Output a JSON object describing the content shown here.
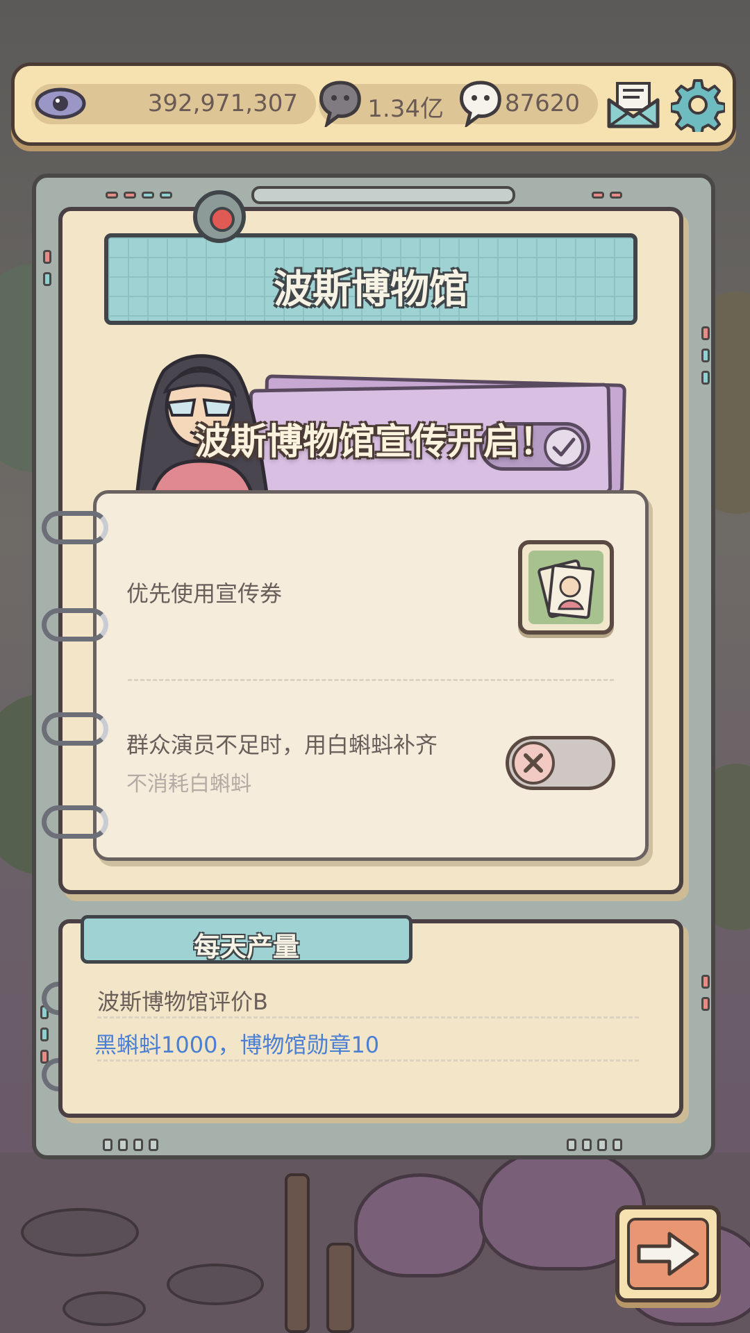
{
  "resources": {
    "views": "392,971,307",
    "gray_tadpoles": "1.34亿",
    "white_tadpoles": "87620"
  },
  "museum": {
    "title": "波斯博物馆",
    "promo_banner": "波斯博物馆宣传开启！"
  },
  "settings": {
    "option1_label": "优先使用宣传券",
    "option2_label": "群众演员不足时，用白蝌蚪补齐",
    "option2_sub": "不消耗白蝌蚪",
    "option2_enabled": false
  },
  "daily_output": {
    "tab_label": "每天产量",
    "rating_line": "波斯博物馆评价B",
    "rewards_line": "黑蝌蚪1000，博物馆勋章10"
  },
  "colors": {
    "accent_teal": "#9fd3d3",
    "reward_blue": "#4a7fd4",
    "paper": "#f3e6c8"
  }
}
